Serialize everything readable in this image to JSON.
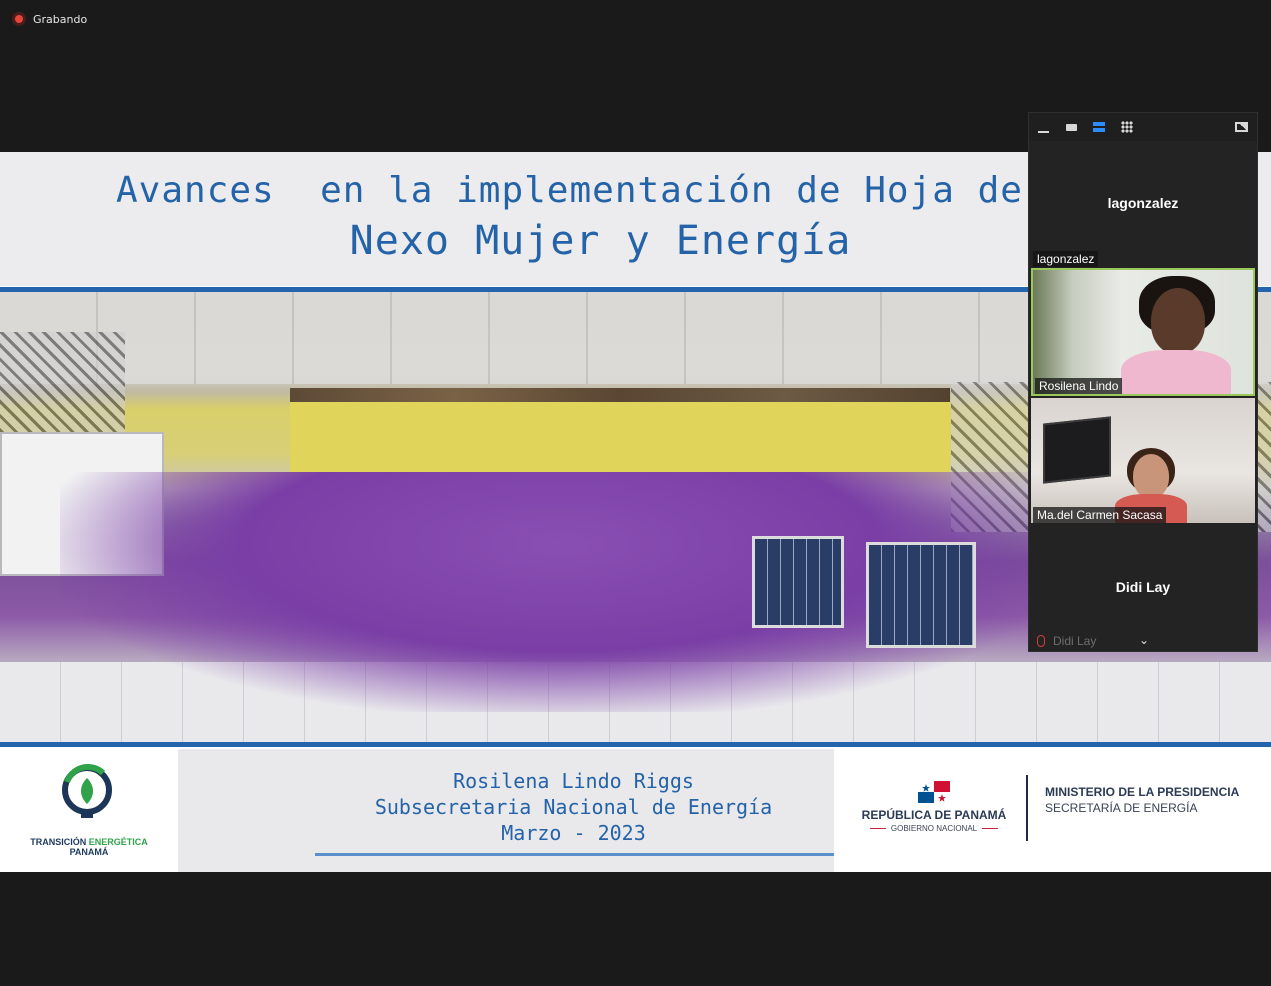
{
  "recording": {
    "label": "Grabando",
    "icon": "recording-dot-icon",
    "color": "#e5453b"
  },
  "slide": {
    "title_line1": "Avances  en la implementación de Hoja de",
    "title_line2": "Nexo Mujer y Energía",
    "accent_color": "#2463a8",
    "footer": {
      "left_logo": {
        "line1_a": "TRANSICIÓN ",
        "line1_b": "ENERGÉTICA",
        "line2": "PANAMÁ"
      },
      "presenter": "Rosilena Lindo Riggs",
      "role": "Subsecretaria Nacional de Energía",
      "date": "Marzo - 2023",
      "gov_name": "REPÚBLICA DE PANAMÁ",
      "gov_sub": "GOBIERNO NACIONAL",
      "ministry": "MINISTERIO DE LA PRESIDENCIA",
      "secretariat": "SECRETARÍA DE ENERGÍA"
    }
  },
  "gallery": {
    "toolbar": [
      "minimize-icon",
      "single-view-icon",
      "speaker-view-icon",
      "gallery-view-icon",
      "pip-icon"
    ],
    "tiles": [
      {
        "center_name": "lagonzalez",
        "label": "lagonzalez"
      },
      {
        "label": "Rosilena Lindo",
        "active": true
      },
      {
        "label": "Ma.del Carmen Sacasa"
      },
      {
        "center_name": "Didi Lay",
        "label": "Didi Lay",
        "muted": true
      }
    ]
  }
}
